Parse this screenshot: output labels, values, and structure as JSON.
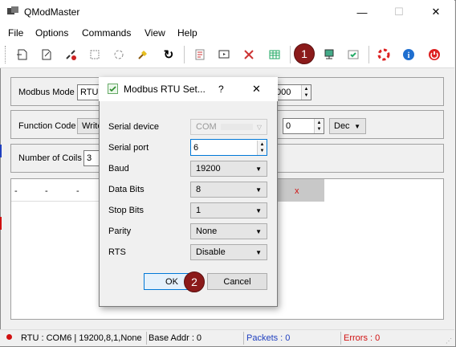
{
  "window": {
    "title": "QModMaster",
    "minimize": "—",
    "maximize": "☐",
    "close": "✕"
  },
  "menu": [
    "File",
    "Options",
    "Commands",
    "View",
    "Help"
  ],
  "main": {
    "modbus_mode_label": "Modbus Mode",
    "modbus_mode_value": "RTU",
    "scan_rate_value": "000",
    "function_code_label": "Function Code",
    "function_code_value": "Write",
    "start_address_value": "0",
    "format_value": "Dec",
    "num_coils_label": "Number of Coils",
    "num_coils_value": "3",
    "table_cells": [
      "-",
      "-",
      "-"
    ],
    "table_x": "x"
  },
  "dialog": {
    "title": "Modbus RTU Set...",
    "help": "?",
    "close": "✕",
    "serial_device_label": "Serial device",
    "serial_device_value": "COM",
    "serial_port_label": "Serial port",
    "serial_port_value": "6",
    "baud_label": "Baud",
    "baud_value": "19200",
    "data_bits_label": "Data Bits",
    "data_bits_value": "8",
    "stop_bits_label": "Stop Bits",
    "stop_bits_value": "1",
    "parity_label": "Parity",
    "parity_value": "None",
    "rts_label": "RTS",
    "rts_value": "Disable",
    "ok_label": "OK",
    "cancel_label": "Cancel"
  },
  "badges": {
    "one": "1",
    "two": "2"
  },
  "status": {
    "connection": "RTU : COM6 | 19200,8,1,None",
    "base_addr": "Base Addr : 0",
    "packets": "Packets : 0",
    "errors": "Errors : 0"
  },
  "colors": {
    "badge": "#8b1a1a",
    "packets": "#1f3fbf",
    "errors": "#d01010",
    "x_red": "#d01010"
  }
}
